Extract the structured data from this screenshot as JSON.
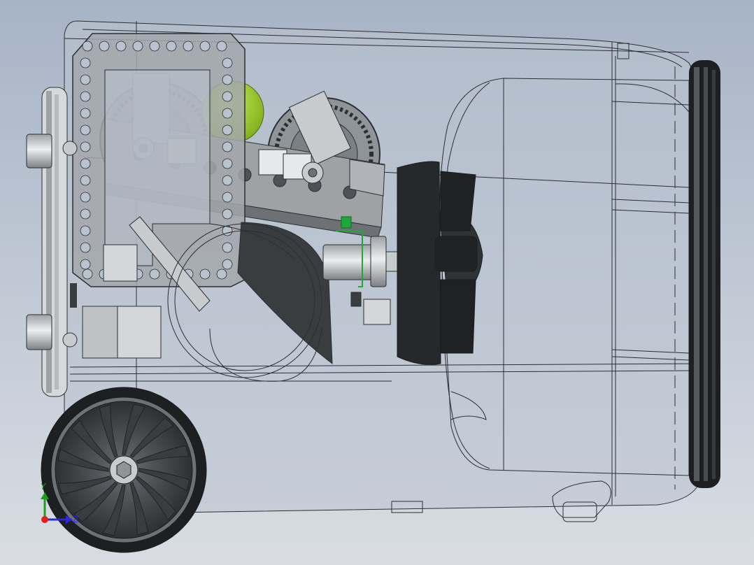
{
  "viewport": {
    "background_top": "#a7b4c6",
    "background_bottom": "#d9dde3"
  },
  "triad": {
    "y_label": "Y",
    "z_label": "Z",
    "x_color": "#e0201c",
    "y_color": "#19a019",
    "z_color": "#2a2ad8"
  },
  "colors": {
    "shell_fill": "#b9c3cf",
    "line": "#2b2f33",
    "metal": "#8f9498",
    "metal_light": "#c8cbce",
    "dark_part": "#3a3d40",
    "ball": "#9ccd2a",
    "tire": "#1d1f21",
    "green_part": "#1ea83a"
  }
}
